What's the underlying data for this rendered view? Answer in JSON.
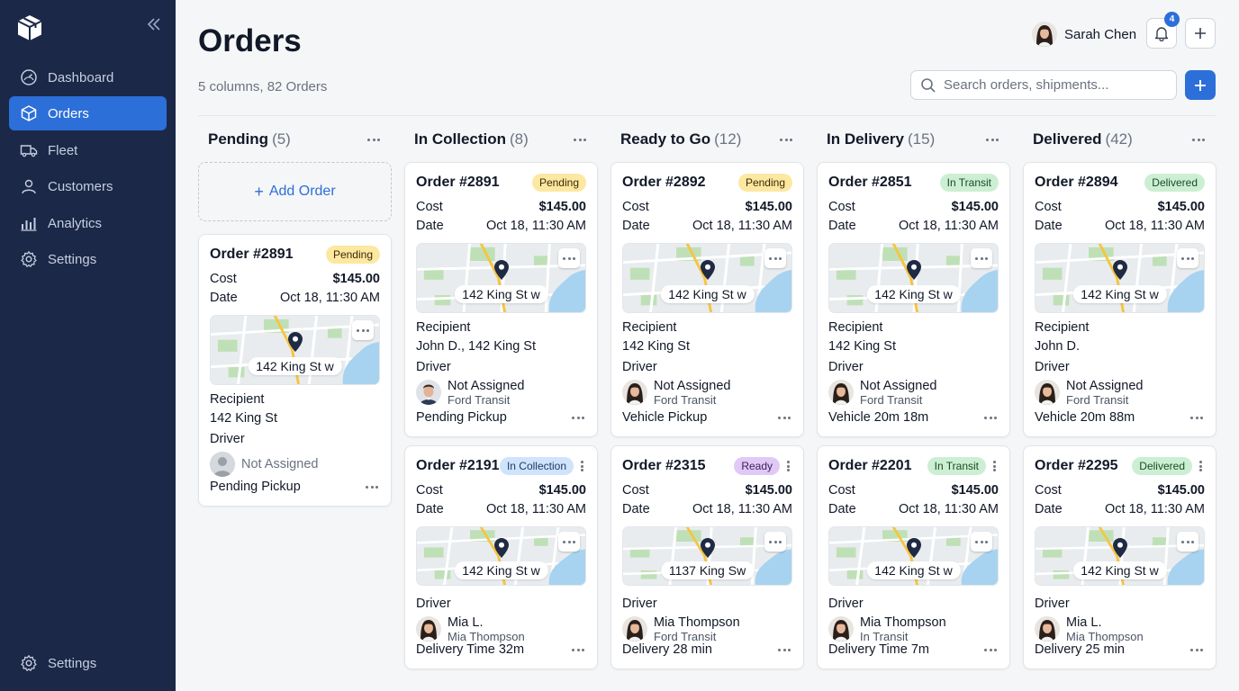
{
  "sidebar": {
    "items": [
      {
        "label": "Dashboard",
        "icon": "dashboard-icon"
      },
      {
        "label": "Orders",
        "icon": "box-icon",
        "active": true
      },
      {
        "label": "Fleet",
        "icon": "truck-icon"
      },
      {
        "label": "Customers",
        "icon": "users-icon"
      },
      {
        "label": "Analytics",
        "icon": "chart-icon"
      },
      {
        "label": "Settings",
        "icon": "gear-icon"
      }
    ],
    "bottom_label": "Settings"
  },
  "header": {
    "title": "Orders",
    "subtitle": "5 columns, 82 Orders",
    "user_name": "Sarah Chen",
    "notification_count": "4",
    "search_placeholder": "Search orders, shipments..."
  },
  "colors": {
    "accent": "#2c6fd9",
    "sidebar": "#1b2847"
  },
  "columns": [
    {
      "name": "Pending",
      "count": "(5)",
      "add_label": "Add Order",
      "cards": [
        {
          "order": "Order #2891",
          "status": "Pending",
          "cost_label": "Cost",
          "cost": "$145.00",
          "date_label": "Date",
          "date": "Oct 18, 11:30 AM",
          "map_address": "142 King St w",
          "recipient_label": "Recipient",
          "recipient": "142 King St",
          "driver_label": "Driver",
          "driver_name": "Not Assigned",
          "footer": "Pending Pickup"
        }
      ]
    },
    {
      "name": "In Collection",
      "count": "(8)",
      "cards": [
        {
          "order": "Order #2891",
          "status": "Pending",
          "cost_label": "Cost",
          "cost": "$145.00",
          "date_label": "Date",
          "date": "Oct 18, 11:30 AM",
          "map_address": "142 King St w",
          "recipient_label": "Recipient",
          "recipient": "John D., 142 King St",
          "driver_label": "Driver",
          "driver_name": "Not Assigned",
          "vehicle": "Ford Transit",
          "footer": "Pending Pickup"
        },
        {
          "order": "Order #2191",
          "status": "In Collection",
          "cost_label": "Cost",
          "cost": "$145.00",
          "date_label": "Date",
          "date": "Oct 18, 11:30 AM",
          "map_address": "142 King St w",
          "driver_label": "Driver",
          "driver_name": "Mia L.",
          "vehicle": "Mia Thompson",
          "footer": "Delivery Time 32m"
        }
      ]
    },
    {
      "name": "Ready to Go",
      "count": "(12)",
      "cards": [
        {
          "order": "Order #2892",
          "status": "Pending",
          "cost_label": "Cost",
          "cost": "$145.00",
          "date_label": "Date",
          "date": "Oct 18, 11:30 AM",
          "map_address": "142 King St w",
          "recipient_label": "Recipient",
          "recipient": "142 King St",
          "driver_label": "Driver",
          "driver_name": "Not Assigned",
          "vehicle": "Ford Transit",
          "footer": "Vehicle Pickup"
        },
        {
          "order": "Order #2315",
          "status": "Ready",
          "cost_label": "Cost",
          "cost": "$145.00",
          "date_label": "Date",
          "date": "Oct 18, 11:30 AM",
          "map_address": "1137 King Sw",
          "driver_label": "Driver",
          "driver_name": "Mia Thompson",
          "vehicle": "Ford Transit",
          "footer": "Delivery 28 min"
        }
      ]
    },
    {
      "name": "In Delivery",
      "count": "(15)",
      "cards": [
        {
          "order": "Order #2851",
          "status": "In Transit",
          "cost_label": "Cost",
          "cost": "$145.00",
          "date_label": "Date",
          "date": "Oct 18, 11:30 AM",
          "map_address": "142 King St w",
          "recipient_label": "Recipient",
          "recipient": "142 King St",
          "driver_label": "Driver",
          "driver_name": "Not Assigned",
          "vehicle": "Ford Transit",
          "footer": "Vehicle 20m 18m"
        },
        {
          "order": "Order #2201",
          "status": "In Transit",
          "cost_label": "Cost",
          "cost": "$145.00",
          "date_label": "Date",
          "date": "Oct 18, 11:30 AM",
          "map_address": "142 King St w",
          "driver_label": "Driver",
          "driver_name": "Mia Thompson",
          "vehicle": "In Transit",
          "footer": "Delivery Time 7m"
        }
      ]
    },
    {
      "name": "Delivered",
      "count": "(42)",
      "cards": [
        {
          "order": "Order #2894",
          "status": "Delivered",
          "cost_label": "Cost",
          "cost": "$145.00",
          "date_label": "Date",
          "date": "Oct 18, 11:30 AM",
          "map_address": "142 King St w",
          "recipient_label": "Recipient",
          "recipient": "John D.",
          "driver_label": "Driver",
          "driver_name": "Not Assigned",
          "vehicle": "Ford Transit",
          "footer": "Vehicle 20m 88m"
        },
        {
          "order": "Order #2295",
          "status": "Delivered",
          "cost_label": "Cost",
          "cost": "$145.00",
          "date_label": "Date",
          "date": "Oct 18, 11:30 AM",
          "map_address": "142 King St w",
          "driver_label": "Driver",
          "driver_name": "Mia L.",
          "vehicle": "Mia Thompson",
          "footer": "Delivery 25 min"
        }
      ]
    }
  ]
}
